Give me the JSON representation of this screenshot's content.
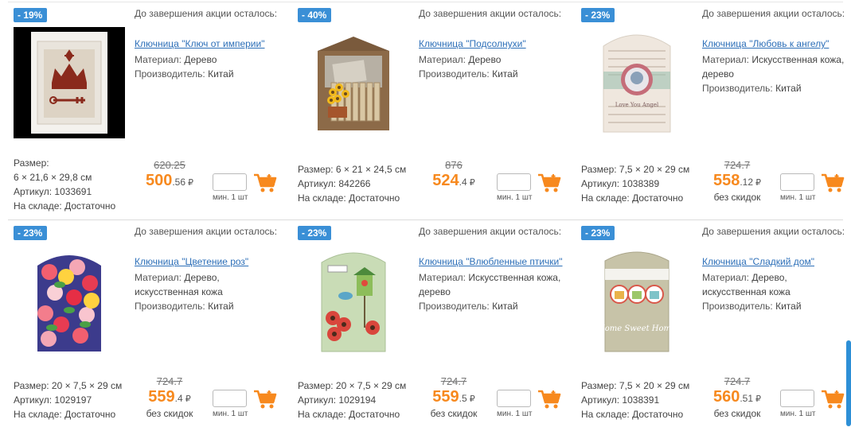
{
  "timer_label": "До завершения акции осталось:",
  "labels": {
    "material": "Материал:",
    "producer": "Производитель:",
    "size": "Размер:",
    "article": "Артикул:",
    "stock": "На складе:",
    "min_qty": "мин. 1 шт",
    "currency": "₽",
    "no_discount": "без скидок"
  },
  "colors": {
    "badge": "#3a8fd6",
    "price": "#f7891e",
    "link": "#2d6fb8",
    "cart": "#f7891e"
  },
  "products": [
    {
      "discount": "- 19%",
      "title": "Ключница \"Ключ от империи\"",
      "material": "Дерево",
      "producer": "Китай",
      "size_line1": "Размер:",
      "size_line2": "6 × 21,6 × 29,8 см",
      "article": "1033691",
      "stock": "Достаточно",
      "old_price": "620.25",
      "price_int": "500",
      "price_frac": ".56",
      "no_discount": ""
    },
    {
      "discount": "- 40%",
      "title": "Ключница \"Подсолнухи\"",
      "material": "Дерево",
      "producer": "Китай",
      "size_line1": "Размер: 6 × 21 × 24,5 см",
      "size_line2": "",
      "article": "842266",
      "stock": "Достаточно",
      "old_price": "876",
      "price_int": "524",
      "price_frac": ".4",
      "no_discount": ""
    },
    {
      "discount": "- 23%",
      "title": "Ключница \"Любовь к ангелу\"",
      "material": "Искусственная кожа, дерево",
      "producer": "Китай",
      "size_line1": "Размер: 7,5 × 20 × 29 см",
      "size_line2": "",
      "article": "1038389",
      "stock": "Достаточно",
      "old_price": "724.7",
      "price_int": "558",
      "price_frac": ".12",
      "no_discount": "без скидок"
    },
    {
      "discount": "- 23%",
      "title": "Ключница \"Цветение роз\"",
      "material": "Дерево, искусственная кожа",
      "producer": "Китай",
      "size_line1": "Размер: 20 × 7,5 × 29 см",
      "size_line2": "",
      "article": "1029197",
      "stock": "Достаточно",
      "old_price": "724.7",
      "price_int": "559",
      "price_frac": ".4",
      "no_discount": "без скидок"
    },
    {
      "discount": "- 23%",
      "title": "Ключница \"Влюбленные птички\"",
      "material": "Искусственная кожа, дерево",
      "producer": "Китай",
      "size_line1": "Размер: 20 × 7,5 × 29 см",
      "size_line2": "",
      "article": "1029194",
      "stock": "Достаточно",
      "old_price": "724.7",
      "price_int": "559",
      "price_frac": ".5",
      "no_discount": "без скидок"
    },
    {
      "discount": "- 23%",
      "title": "Ключница \"Сладкий дом\"",
      "material": "Дерево, искусственная кожа",
      "producer": "Китай",
      "size_line1": "Размер: 7,5 × 20 × 29 см",
      "size_line2": "",
      "article": "1038391",
      "stock": "Достаточно",
      "old_price": "724.7",
      "price_int": "560",
      "price_frac": ".51",
      "no_discount": "без скидок"
    }
  ]
}
